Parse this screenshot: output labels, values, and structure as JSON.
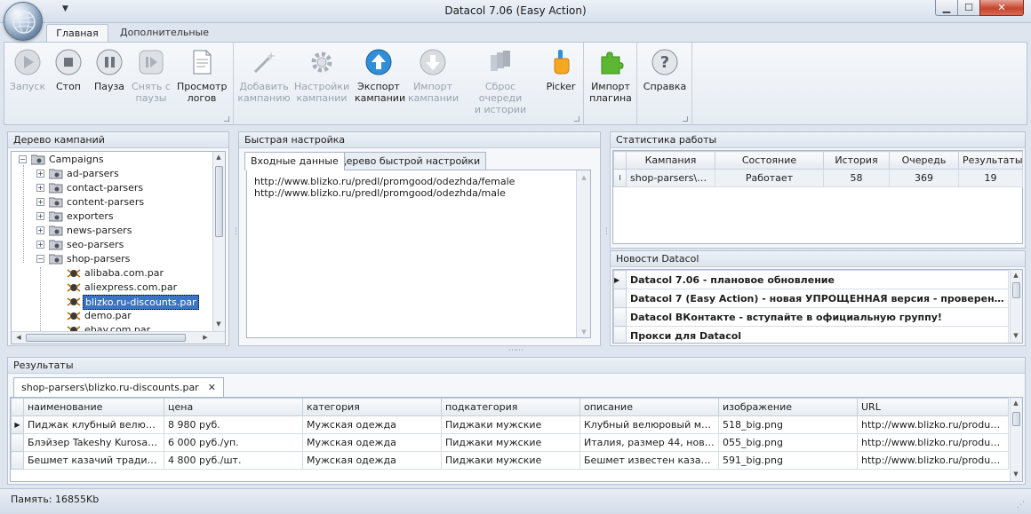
{
  "window": {
    "title": "Datacol 7.06 (Easy Action)"
  },
  "ribbon_tabs": {
    "main": "Главная",
    "extra": "Дополнительные"
  },
  "ribbon": {
    "start": "Запуск",
    "stop": "Стоп",
    "pause": "Пауза",
    "unpause_1": "Снять с",
    "unpause_2": "паузы",
    "view_logs_1": "Просмотр",
    "view_logs_2": "логов",
    "add_campaign_1": "Добавить",
    "add_campaign_2": "кампанию",
    "campaign_settings_1": "Настройки",
    "campaign_settings_2": "кампании",
    "export_campaigns_1": "Экспорт",
    "export_campaigns_2": "кампании",
    "import_campaigns_1": "Импорт",
    "import_campaigns_2": "кампании",
    "reset_queue_1": "Сброс очереди",
    "reset_queue_2": "и истории",
    "picker": "Picker",
    "import_plugin_1": "Импорт",
    "import_plugin_2": "плагина",
    "help": "Справка"
  },
  "tree_panel": {
    "title": "Дерево кампаний",
    "root": "Campaigns",
    "folders": [
      "ad-parsers",
      "contact-parsers",
      "content-parsers",
      "exporters",
      "news-parsers",
      "seo-parsers",
      "shop-parsers"
    ],
    "files": [
      "alibaba.com.par",
      "aliexpress.com.par",
      "blizko.ru-discounts.par",
      "demo.par",
      "ebay.com.par"
    ]
  },
  "quick_panel": {
    "title": "Быстрая настройка",
    "tab_input": "Входные данные",
    "tab_tree": "Дерево быстрой настройки",
    "lines": [
      "http://www.blizko.ru/predl/promgood/odezhda/female",
      "http://www.blizko.ru/predl/promgood/odezhda/male"
    ]
  },
  "stats_panel": {
    "title": "Статистика работы",
    "columns": [
      "Кампания",
      "Состояние",
      "История",
      "Очередь",
      "Результаты"
    ],
    "row": {
      "campaign": "shop-parsers\\bli...",
      "state": "Работает",
      "history": "58",
      "queue": "369",
      "results": "19"
    }
  },
  "news_panel": {
    "title": "Новости Datacol",
    "items": [
      "Datacol 7.06 - плановое обновление",
      "Datacol 7 (Easy Action) - новая УПРОЩЕННАЯ версия - проверено на \"...",
      "Datacol ВКонтакте - вступайте в официальную группу!",
      "Прокси для Datacol"
    ]
  },
  "results_panel": {
    "title": "Результаты",
    "tab": "shop-parsers\\blizko.ru-discounts.par",
    "columns": [
      "наименование",
      "цена",
      "категория",
      "подкатегория",
      "описание",
      "изображение",
      "URL"
    ],
    "rows": [
      [
        "Пиджак клубный велюровый",
        "8 980 руб.",
        "Мужская одежда",
        "Пиджаки мужские",
        "Клубный велюровый мужс...",
        "518_big.png",
        "http://www.blizko.ru/produc..."
      ],
      [
        "Блэйзер Takeshy Kurosawa",
        "6 000 руб./уп.",
        "Мужская одежда",
        "Пиджаки мужские",
        "Италия, размер 44, новый ...",
        "055_big.png",
        "http://www.blizko.ru/produc..."
      ],
      [
        "Бешмет казачий традицио...",
        "4 800 руб./шт.",
        "Мужская одежда",
        "Пиджаки мужские",
        "Бешмет известен казакам с...",
        "591_big.png",
        "http://www.blizko.ru/produc..."
      ]
    ]
  },
  "status": {
    "memory": "Память: 16855Kb"
  },
  "colors": {
    "accent": "#3b74c4",
    "ribbon_bg": "#eef2f7",
    "close_red": "#c6442d"
  }
}
